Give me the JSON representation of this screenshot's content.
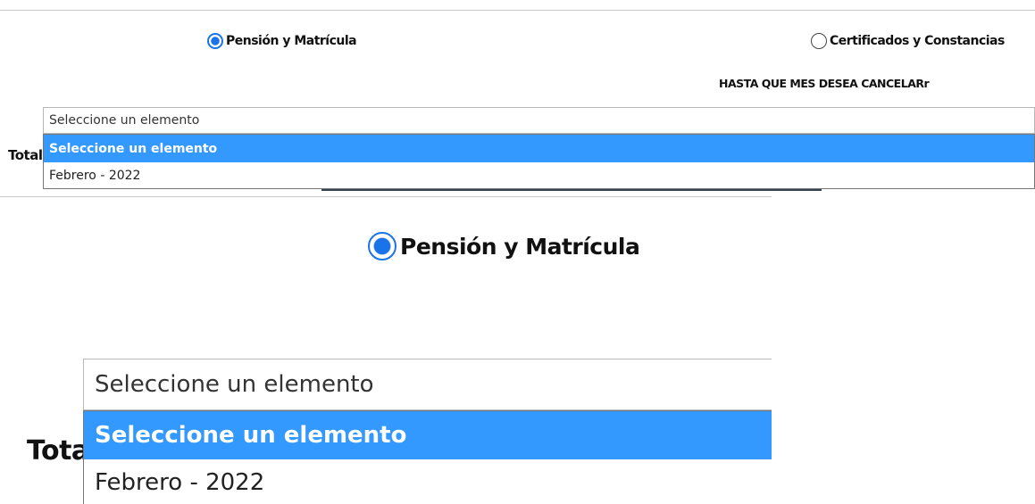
{
  "payment_type": {
    "options": [
      {
        "label": "Pensión y Matrícula",
        "checked": true
      },
      {
        "label": "Certificados y Constancias",
        "checked": false
      }
    ]
  },
  "month_prompt": "HASTA QUE MES DESEA CANCELARr",
  "total_label": "Total",
  "month_select": {
    "value": "Seleccione un elemento",
    "options": [
      {
        "label": "Seleccione un elemento",
        "selected": true
      },
      {
        "label": "Febrero - 2022",
        "selected": false
      }
    ]
  },
  "colors": {
    "highlight": "#3399ff",
    "radio_accent": "#1a73e8"
  }
}
